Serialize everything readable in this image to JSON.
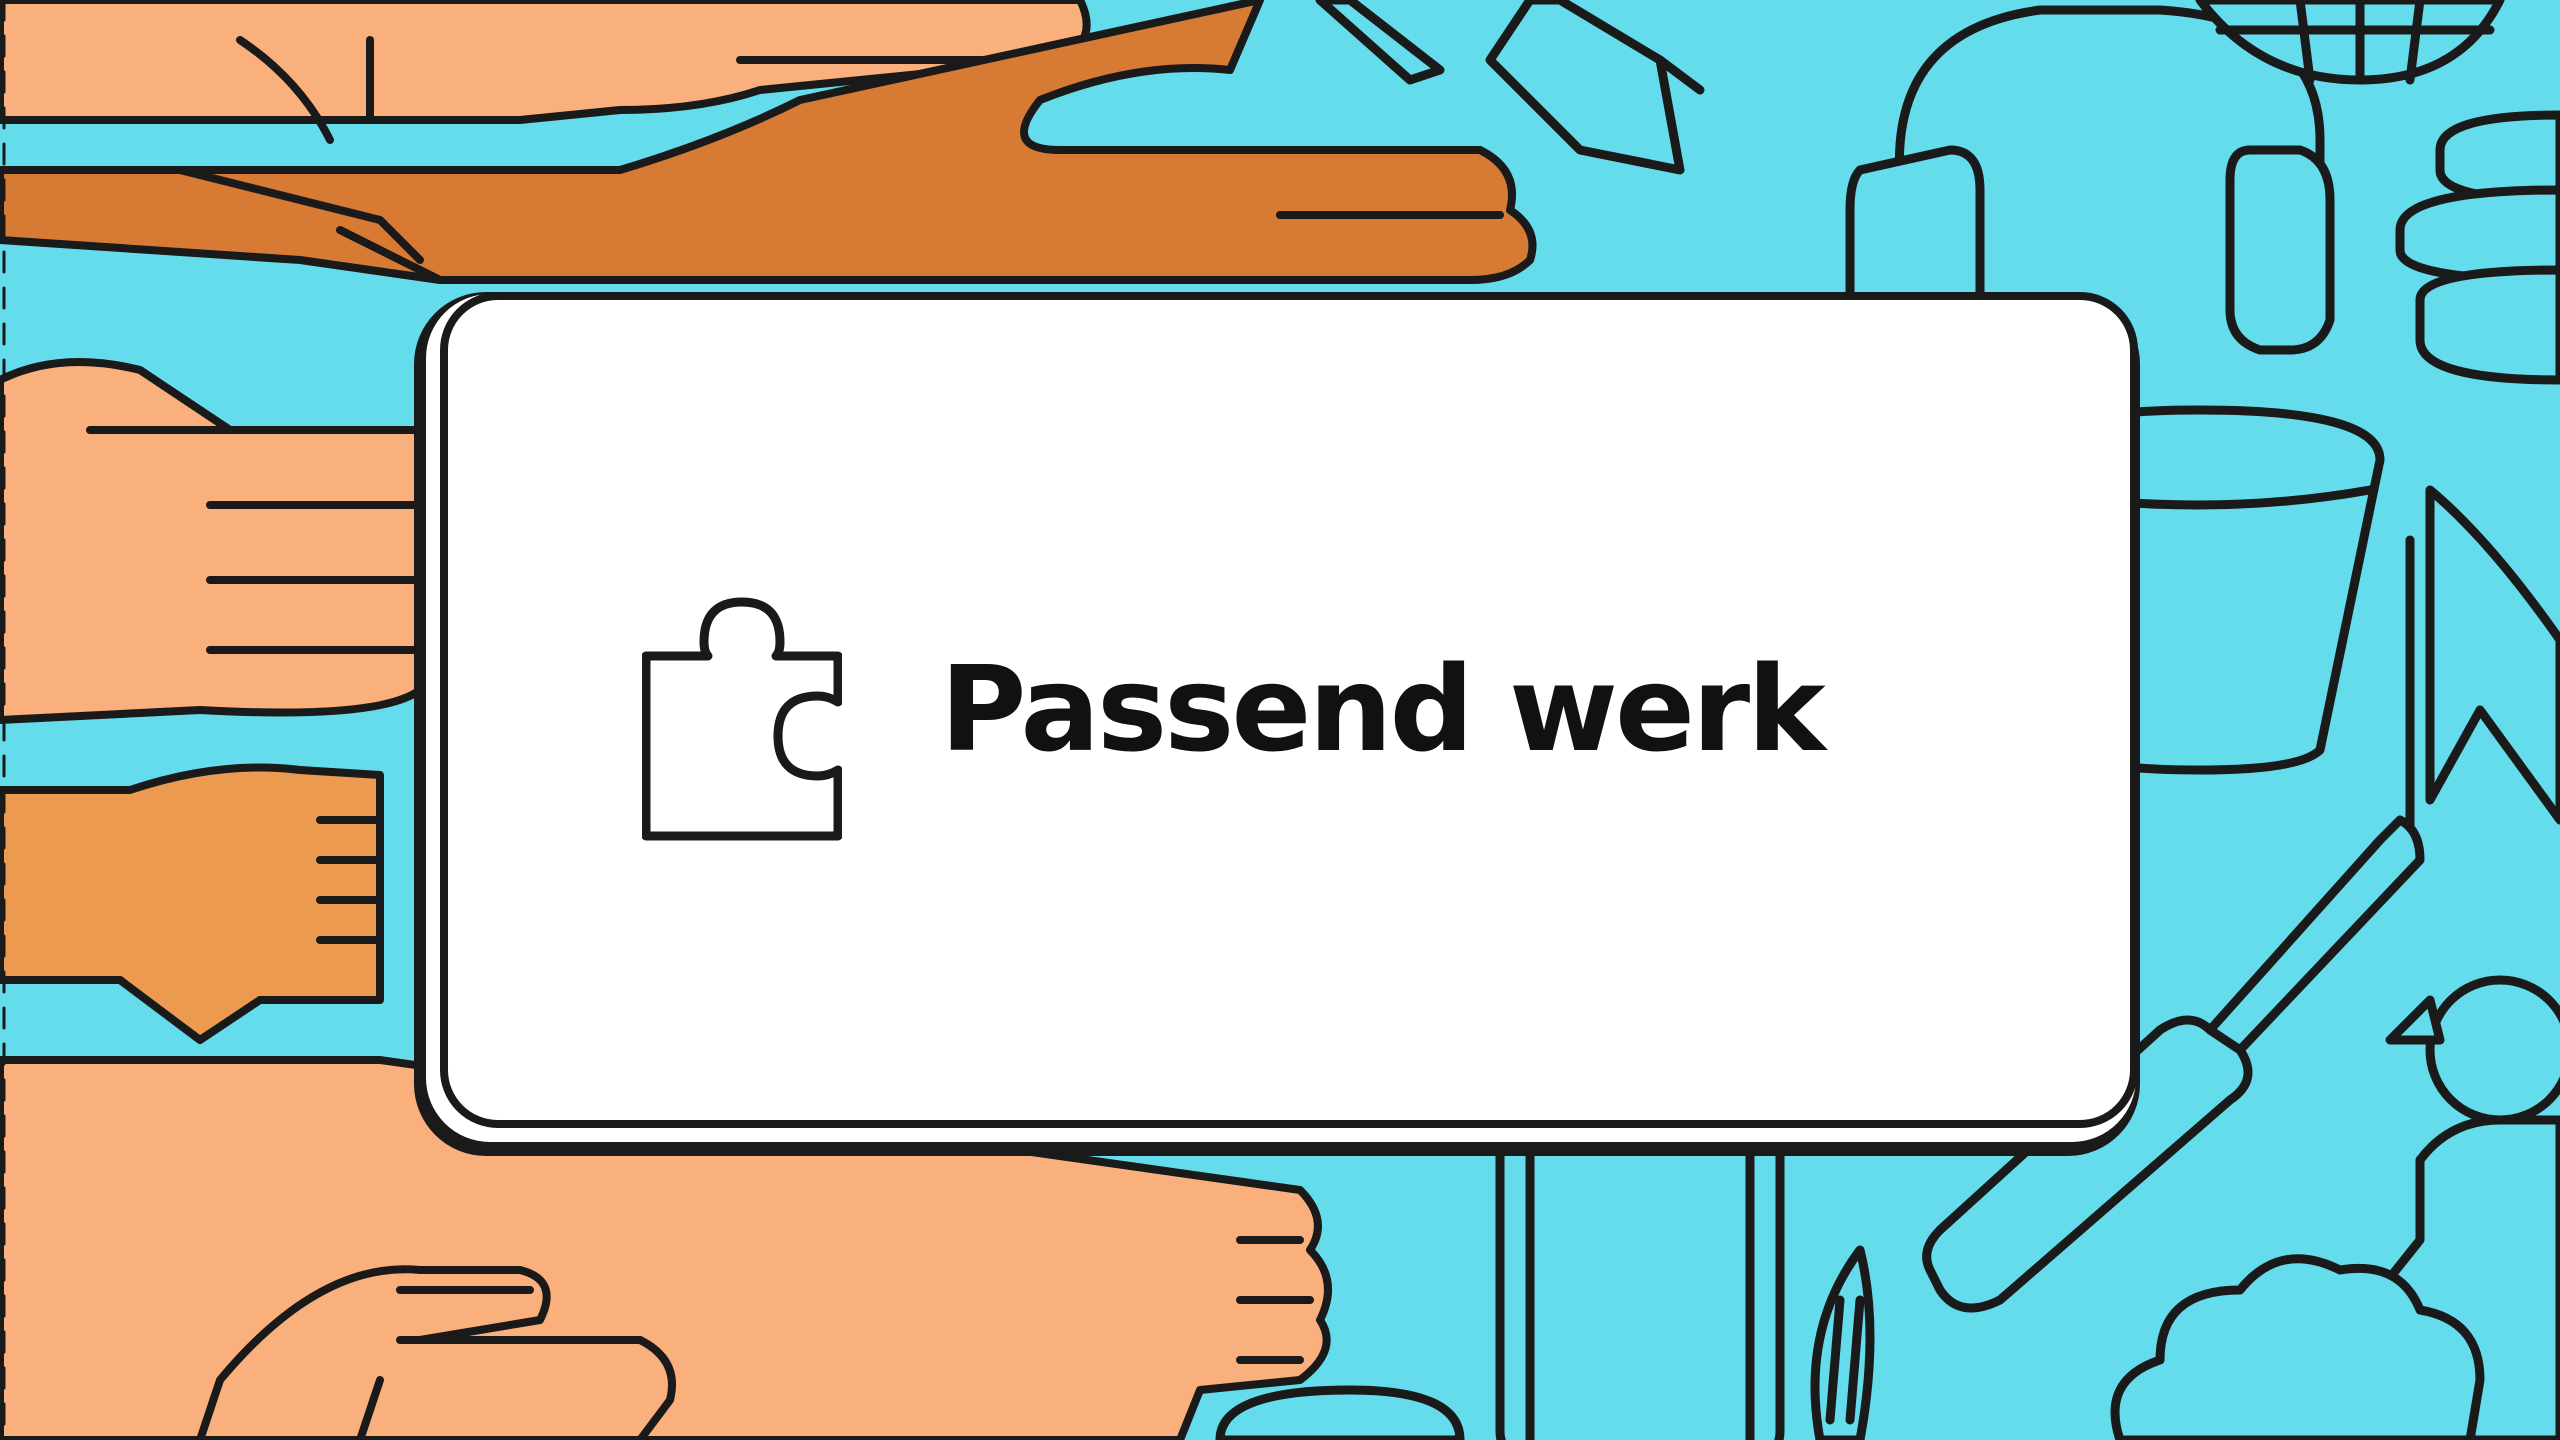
{
  "header": {
    "title": "Passend werk"
  },
  "icons": {
    "main": "puzzle-piece-icon",
    "background": [
      "hands-illustration",
      "pencil-icon",
      "headphones-icon",
      "globe-icon",
      "coins-icon",
      "bucket-icon",
      "cursor-icon",
      "screwdriver-icon",
      "child-icon",
      "smartphone-icon",
      "bowl-icon",
      "cloud-icon",
      "brush-icon"
    ]
  },
  "colors": {
    "background": "#64dcec",
    "skin_light": "#f9b07c",
    "skin_medium": "#eb9a50",
    "skin_dark": "#d67a34",
    "outline": "#1a1a1a",
    "card": "#ffffff"
  }
}
